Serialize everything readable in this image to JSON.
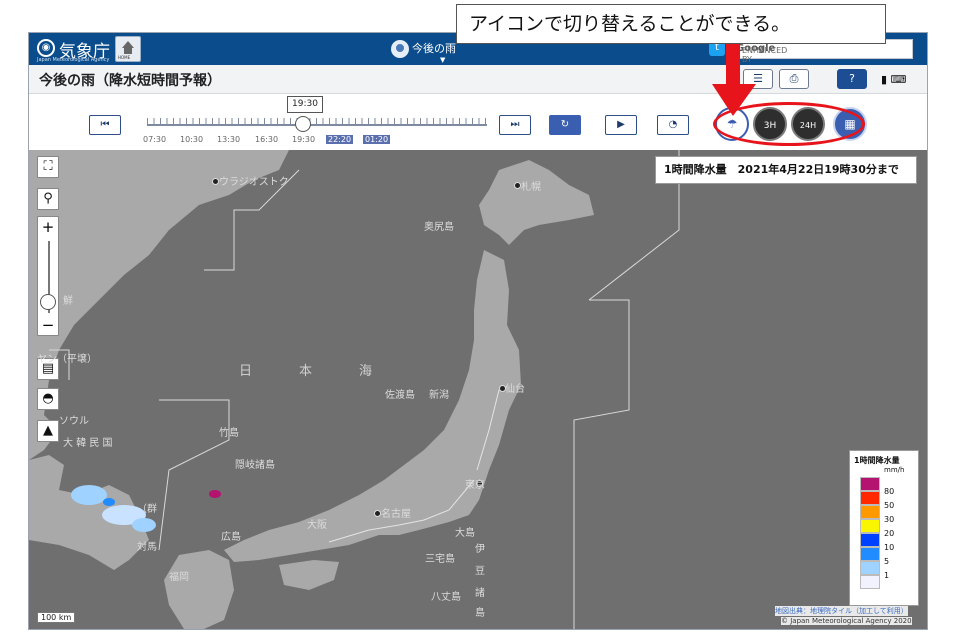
{
  "header": {
    "logo_title": "気象庁",
    "logo_subtitle": "Japan Meteorological Agency",
    "home_label": "HOME",
    "center_title": "今後の雨",
    "search_prefix": "ENHANCED BY",
    "search_brand": "Google"
  },
  "title_row": {
    "page_title": "今後の雨（降水短時間予報）"
  },
  "time_control": {
    "current_time": "19:30",
    "tick_labels": [
      "07:30",
      "10:30",
      "13:30",
      "16:30",
      "19:30",
      "22:20",
      "01:20"
    ],
    "highlighted_ticks": [
      "22:20",
      "01:20"
    ]
  },
  "layer_buttons": [
    {
      "name": "rain-amount",
      "state": "active"
    },
    {
      "name": "3h",
      "label": "3H"
    },
    {
      "name": "24h",
      "label": "24H"
    },
    {
      "name": "grid"
    }
  ],
  "annotation": {
    "callout_text": "アイコンで切り替えることができる。",
    "colors": {
      "highlight": "#e8141b"
    }
  },
  "map": {
    "amount_title": "1時間降水量　2021年4月22日19時30分まで",
    "labels": {
      "vladivostok": "ウラジオストク",
      "sapporo": "札幌",
      "okushiri": "奥尻島",
      "sea1": "日",
      "sea2": "本",
      "sea3": "海",
      "sado": "佐渡島",
      "niigata": "新潟",
      "sendai": "仙台",
      "north_korea1": "鮮",
      "pyongyang": "ヤン（平壌）",
      "seoul": "ソウル",
      "korea": "大 韓 民 国",
      "takeshima": "竹島",
      "oki": "隠岐諸島",
      "tokyo": "東京",
      "nagoya": "名古屋",
      "osaka": "大阪",
      "hiroshima": "広島",
      "fukuoka": "福岡",
      "oshima": "大島",
      "miyake": "三宅島",
      "izu1": "伊",
      "izu2": "豆",
      "izu3": "諸",
      "izu4": "島",
      "hachijo": "八丈島",
      "tsushima": "対馬",
      "gunsan": "（群"
    },
    "scale": "100 km",
    "credit": "地図出典：地理院タイル（加工して利用）",
    "copyright": "© Japan Meteorological Agency 2020"
  },
  "legend": {
    "title": "1時間降水量",
    "unit": "mm/h",
    "items": [
      {
        "value": "80",
        "color": "#b4136f"
      },
      {
        "value": "50",
        "color": "#ff2800"
      },
      {
        "value": "30",
        "color": "#ff9900"
      },
      {
        "value": "20",
        "color": "#faf500"
      },
      {
        "value": "10",
        "color": "#0041ff"
      },
      {
        "value": "5",
        "color": "#218cff"
      },
      {
        "value": "1",
        "color": "#a0d2ff"
      },
      {
        "value": "",
        "color": "#f2f2ff"
      }
    ]
  }
}
